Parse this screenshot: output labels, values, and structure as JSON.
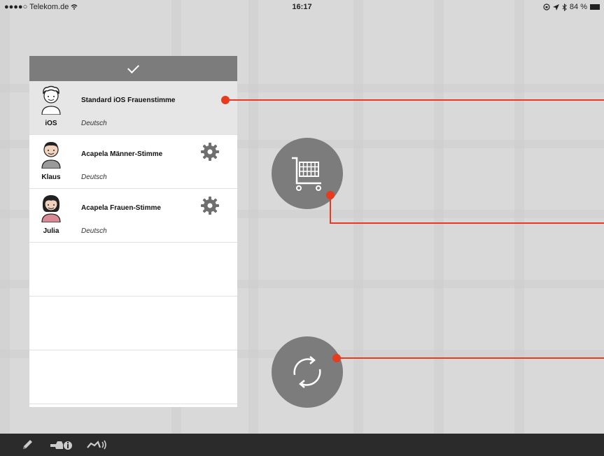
{
  "status_bar": {
    "carrier": "●●●●○ Telekom.de",
    "time": "16:17",
    "battery": "84 %"
  },
  "voices": [
    {
      "nickname": "iOS",
      "name": "Standard iOS Frauenstimme",
      "language": "Deutsch",
      "selected": true,
      "has_settings": false
    },
    {
      "nickname": "Klaus",
      "name": "Acapela Männer-Stimme",
      "language": "Deutsch",
      "selected": false,
      "has_settings": true
    },
    {
      "nickname": "Julia",
      "name": "Acapela Frauen-Stimme",
      "language": "Deutsch",
      "selected": false,
      "has_settings": true
    }
  ],
  "icons": {
    "header": "checkmark-icon",
    "shop": "shopping-cart-icon",
    "refresh": "refresh-icon",
    "settings": "gear-icon",
    "bottom": [
      "pencil-icon",
      "pointing-hand-icon",
      "speech-icon"
    ]
  },
  "colors": {
    "annotation": "#e83a1e",
    "button": "#7c7c7c",
    "header": "#7c7c7c",
    "bottom_bar": "#2b2b2b"
  }
}
